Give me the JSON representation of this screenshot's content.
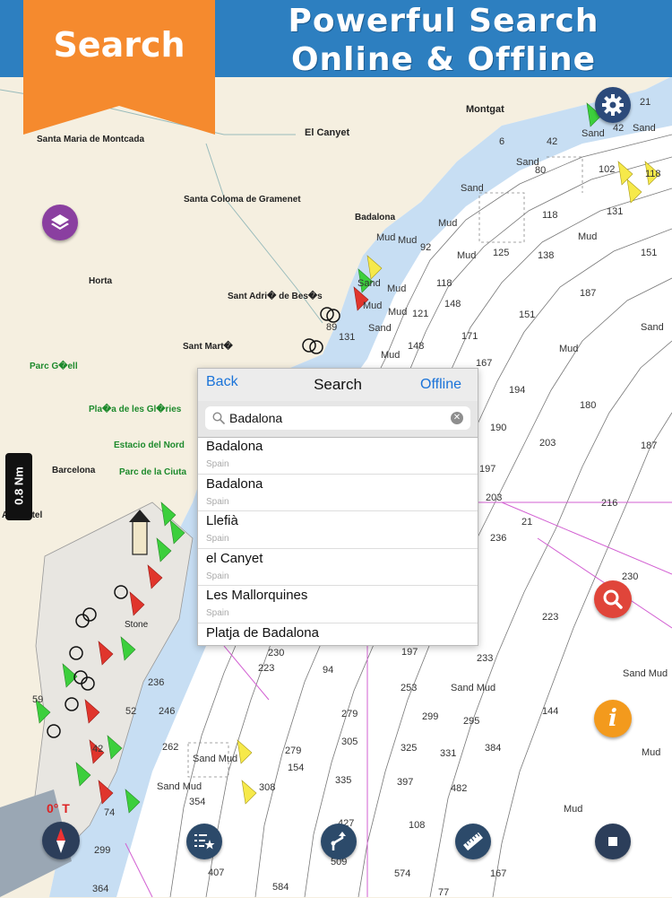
{
  "banner": {
    "ribbon_label": "Search",
    "title_line1": "Powerful Search",
    "title_line2": "Online & Offline",
    "ribbon_color": "#f58a2e",
    "banner_color": "#2d7fc0"
  },
  "map": {
    "places": [
      {
        "id": "montgat",
        "label": "Montgat"
      },
      {
        "id": "el-canyet",
        "label": "El Canyet"
      },
      {
        "id": "santa-maria",
        "label": "Santa Maria de Montcada"
      },
      {
        "id": "santa-coloma",
        "label": "Santa Coloma de Gramenet"
      },
      {
        "id": "badalona",
        "label": "Badalona"
      },
      {
        "id": "horta",
        "label": "Horta"
      },
      {
        "id": "sant-adria",
        "label": "Sant Adri� de Bes�s"
      },
      {
        "id": "sant-marti",
        "label": "Sant Mart�"
      },
      {
        "id": "parc-guell",
        "label": "Parc G�ell"
      },
      {
        "id": "placa-glories",
        "label": "Pla�a de les Gl�ries"
      },
      {
        "id": "estacio-nord",
        "label": "Estacio del Nord"
      },
      {
        "id": "barcelona",
        "label": "Barcelona"
      },
      {
        "id": "parc-ciutat",
        "label": "Parc de la Ciuta"
      },
      {
        "id": "hotel",
        "label": "A� Hotel"
      },
      {
        "id": "stone",
        "label": "Stone"
      }
    ],
    "depths": [
      {
        "id": "d1",
        "label": "21"
      },
      {
        "id": "d2",
        "label": "42"
      },
      {
        "id": "d3",
        "label": "Sand"
      },
      {
        "id": "d4",
        "label": "42"
      },
      {
        "id": "d5",
        "label": "Sand"
      },
      {
        "id": "d6",
        "label": "6"
      },
      {
        "id": "d7",
        "label": "80"
      },
      {
        "id": "d8",
        "label": "Sand"
      },
      {
        "id": "d9",
        "label": "102"
      },
      {
        "id": "d10",
        "label": "118"
      },
      {
        "id": "d11",
        "label": "Sand"
      },
      {
        "id": "d12",
        "label": "118"
      },
      {
        "id": "d13",
        "label": "131"
      },
      {
        "id": "d14",
        "label": "Mud"
      },
      {
        "id": "d15",
        "label": "Mud"
      },
      {
        "id": "d16",
        "label": "Mud"
      },
      {
        "id": "d17",
        "label": "92"
      },
      {
        "id": "d18",
        "label": "125"
      },
      {
        "id": "d19",
        "label": "138"
      },
      {
        "id": "d20",
        "label": "Mud"
      },
      {
        "id": "d21",
        "label": "151"
      },
      {
        "id": "d22",
        "label": "Mud"
      },
      {
        "id": "d23",
        "label": "Sand"
      },
      {
        "id": "d24",
        "label": "118"
      },
      {
        "id": "d25",
        "label": "Mud"
      },
      {
        "id": "d26",
        "label": "Mud"
      },
      {
        "id": "d27",
        "label": "121"
      },
      {
        "id": "d28",
        "label": "Mud"
      },
      {
        "id": "d29",
        "label": "148"
      },
      {
        "id": "d30",
        "label": "151"
      },
      {
        "id": "d31",
        "label": "187"
      },
      {
        "id": "d32",
        "label": "Sand"
      },
      {
        "id": "d33",
        "label": "89"
      },
      {
        "id": "d34",
        "label": "Sand"
      },
      {
        "id": "d35",
        "label": "131"
      },
      {
        "id": "d36",
        "label": "148"
      },
      {
        "id": "d37",
        "label": "171"
      },
      {
        "id": "d38",
        "label": "Mud"
      },
      {
        "id": "d39",
        "label": "Mud"
      },
      {
        "id": "d40",
        "label": "167"
      },
      {
        "id": "d41",
        "label": "194"
      },
      {
        "id": "d42",
        "label": "180"
      },
      {
        "id": "d43",
        "label": "190"
      },
      {
        "id": "d44",
        "label": "203"
      },
      {
        "id": "d45",
        "label": "187"
      },
      {
        "id": "d46",
        "label": "197"
      },
      {
        "id": "d47",
        "label": "203"
      },
      {
        "id": "d48",
        "label": "216"
      },
      {
        "id": "d49",
        "label": "21"
      },
      {
        "id": "d50",
        "label": "236"
      },
      {
        "id": "d51",
        "label": "230"
      },
      {
        "id": "d52",
        "label": "223"
      },
      {
        "id": "d53",
        "label": "233"
      },
      {
        "id": "d54",
        "label": "Sand Mud"
      },
      {
        "id": "d55",
        "label": "230"
      },
      {
        "id": "d56",
        "label": "197"
      },
      {
        "id": "d57",
        "label": "223"
      },
      {
        "id": "d58",
        "label": "94"
      },
      {
        "id": "d59",
        "label": "236"
      },
      {
        "id": "d60",
        "label": "253"
      },
      {
        "id": "d61",
        "label": "Sand Mud"
      },
      {
        "id": "d62",
        "label": "246"
      },
      {
        "id": "d63",
        "label": "279"
      },
      {
        "id": "d64",
        "label": "299"
      },
      {
        "id": "d65",
        "label": "295"
      },
      {
        "id": "d66",
        "label": "144"
      },
      {
        "id": "d67",
        "label": "262"
      },
      {
        "id": "d68",
        "label": "279"
      },
      {
        "id": "d69",
        "label": "305"
      },
      {
        "id": "d70",
        "label": "325"
      },
      {
        "id": "d71",
        "label": "331"
      },
      {
        "id": "d72",
        "label": "384"
      },
      {
        "id": "d73",
        "label": "Mud"
      },
      {
        "id": "d74",
        "label": "Sand Mud"
      },
      {
        "id": "d75",
        "label": "154"
      },
      {
        "id": "d76",
        "label": "Sand Mud"
      },
      {
        "id": "d77",
        "label": "308"
      },
      {
        "id": "d78",
        "label": "335"
      },
      {
        "id": "d79",
        "label": "397"
      },
      {
        "id": "d80",
        "label": "482"
      },
      {
        "id": "d81",
        "label": "Mud"
      },
      {
        "id": "d82",
        "label": "354"
      },
      {
        "id": "d83",
        "label": "427"
      },
      {
        "id": "d84",
        "label": "108"
      },
      {
        "id": "d85",
        "label": "299"
      },
      {
        "id": "d86",
        "label": "407"
      },
      {
        "id": "d87",
        "label": "509"
      },
      {
        "id": "d88",
        "label": "574"
      },
      {
        "id": "d89",
        "label": "167"
      },
      {
        "id": "d90",
        "label": "364"
      },
      {
        "id": "d91",
        "label": "584"
      },
      {
        "id": "d92",
        "label": "77"
      },
      {
        "id": "d93",
        "label": "74"
      },
      {
        "id": "d94",
        "label": "52"
      },
      {
        "id": "d95",
        "label": "42"
      },
      {
        "id": "d96",
        "label": "59"
      }
    ],
    "scale_label": "0.8 Nm",
    "compass_label": "0° T"
  },
  "search_panel": {
    "back_label": "Back",
    "title": "Search",
    "offline_label": "Offline",
    "query": "Badalona",
    "clear_symbol": "✕",
    "results": [
      {
        "name": "Badalona",
        "country": "Spain"
      },
      {
        "name": "Badalona",
        "country": "Spain"
      },
      {
        "name": "Llefià",
        "country": "Spain"
      },
      {
        "name": "el Canyet",
        "country": "Spain"
      },
      {
        "name": "Les Mallorquines",
        "country": "Spain"
      },
      {
        "name": "Platja de  Badalona",
        "country": ""
      }
    ]
  },
  "buttons": {
    "settings_icon": "gear-icon",
    "layers_icon": "layers-icon",
    "search_icon": "magnifier-icon",
    "info_icon": "info-icon",
    "info_symbol": "i",
    "compass_icon": "compass-icon",
    "favorites_icon": "list-star-icon",
    "route_icon": "route-icon",
    "measure_icon": "ruler-icon",
    "record_icon": "stop-icon"
  },
  "colors": {
    "land": "#f5efe0",
    "shallow_water": "#c7def3",
    "deep_water": "#ffffff",
    "accent_blue": "#1a73d9",
    "search_button": "#e0453a",
    "info_button": "#f39a1d",
    "layers_button": "#8a3fa0"
  }
}
